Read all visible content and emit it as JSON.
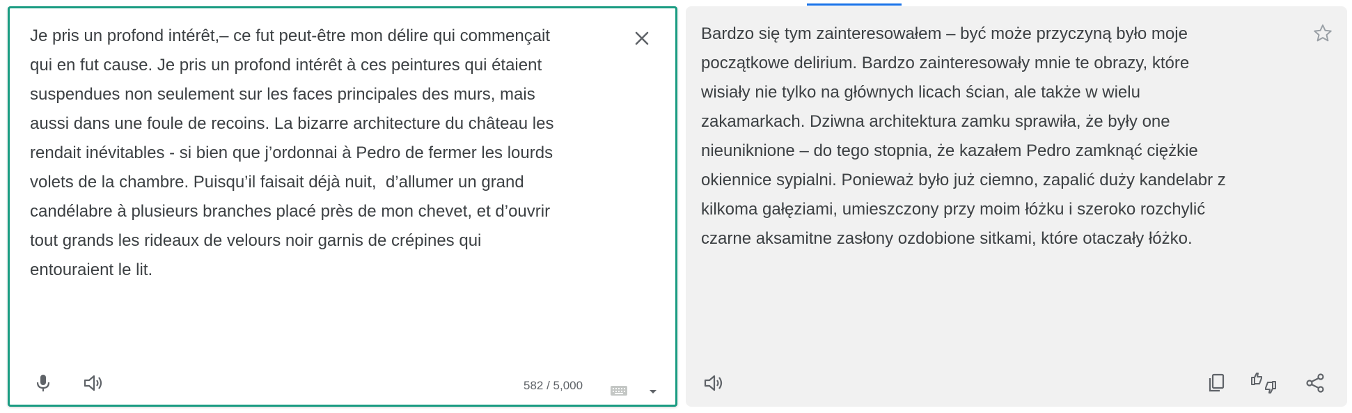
{
  "source": {
    "text": "Je pris un profond intérêt,– ce fut peut-être mon délire qui commençait\nqui en fut cause. Je pris un profond intérêt à ces peintures qui étaient\nsuspendues non seulement sur les faces principales des murs, mais\naussi dans une foule de recoins. La bizarre architecture du château les\nrendait inévitables - si bien que j’ordonnai à Pedro de fermer les lourds\nvolets de la chambre. Puisqu’il faisait déjà nuit,  d’allumer un grand\ncandélabre à plusieurs branches placé près de mon chevet, et d’ouvrir\ntout grands les rideaux de velours noir garnis de crépines qui\nentouraient le lit.",
    "char_count": "582 / 5,000",
    "icons": {
      "clear": "close-icon",
      "mic": "microphone-icon",
      "listen": "speaker-icon",
      "keyboard": "keyboard-icon",
      "menu": "caret-down-icon"
    }
  },
  "target": {
    "text": "Bardzo się tym zainteresowałem – być może przyczyną było moje\npoczątkowe delirium. Bardzo zainteresowały mnie te obrazy, które\nwisiały nie tylko na głównych licach ścian, ale także w wielu\nzakamarkach. Dziwna architektura zamku sprawiła, że były one\nnieuniknione – do tego stopnia, że kazałem Pedro zamknąć ciężkie\nokiennice sypialni. Ponieważ było już ciemno, zapalić duży kandelabr z\nkilkoma gałęziami, umieszczony przy moim łóżku i szeroko rozchylić\nczarne aksamitne zasłony ozdobione sitkami, które otaczały łóżko.",
    "icons": {
      "save": "star-icon",
      "listen": "speaker-icon",
      "copy": "copy-icon",
      "rate": "thumbs-icon",
      "share": "share-icon"
    }
  },
  "colors": {
    "accent": "#1a9c82",
    "progress": "#1a73e8",
    "text": "#3c4043",
    "icon": "#5f6368",
    "target_bg": "#f1f1f1"
  }
}
